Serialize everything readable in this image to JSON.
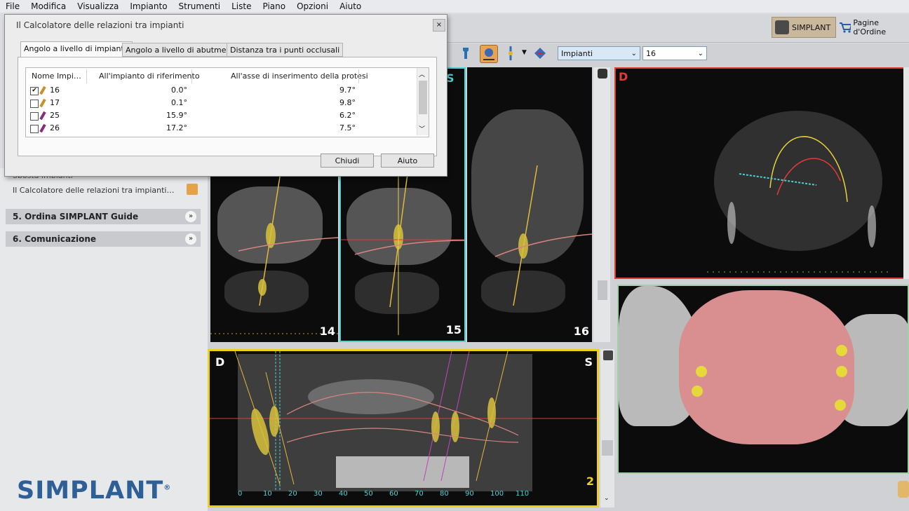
{
  "menu": [
    "File",
    "Modifica",
    "Visualizza",
    "Impianto",
    "Strumenti",
    "Liste",
    "Piano",
    "Opzioni",
    "Aiuto"
  ],
  "toolbar": {
    "simplant_tab": "SIMPLANT",
    "ordini_tab": "Pagine d'Ordine",
    "select_implants": "Impianti",
    "select_number": "16"
  },
  "dialog": {
    "title": "Il Calcolatore delle relazioni tra impianti",
    "close": "×",
    "tabs": [
      "Angolo a livello di impianto",
      "Angolo a livello di abutment",
      "Distanza tra i punti occlusali"
    ],
    "columns": [
      "Nome Impi…",
      "All'impianto di riferimento",
      "All'asse di inserimento della protesi"
    ],
    "rows": [
      {
        "checked": "✔",
        "id": "16",
        "ref": "0.0°",
        "prot": "9.7°",
        "pen": "#c8912a"
      },
      {
        "checked": "",
        "id": "17",
        "ref": "0.1°",
        "prot": "9.8°",
        "pen": "#c8912a"
      },
      {
        "checked": "",
        "id": "25",
        "ref": "15.9°",
        "prot": "6.2°",
        "pen": "#8b2b7a"
      },
      {
        "checked": "",
        "id": "26",
        "ref": "17.2°",
        "prot": "7.5°",
        "pen": "#8b2b7a"
      }
    ],
    "buttons": {
      "close": "Chiudi",
      "help": "Aiuto"
    }
  },
  "left_panel": {
    "truncated_item": "Sposta impianti",
    "calc_item": "Il Calcolatore delle relazioni tra impianti…",
    "section5": "5. Ordina SIMPLANT Guide",
    "section6": "6. Comunicazione",
    "chevron": "»",
    "brand": "SIMPLANT",
    "brand_reg": "®"
  },
  "views": {
    "slice_labels": [
      "14",
      "15",
      "16"
    ],
    "slice_side": "S",
    "axial_side": "D",
    "pano_left": "D",
    "pano_right": "S",
    "pano_number": "2",
    "pano_ruler": [
      "0",
      "10",
      "20",
      "30",
      "40",
      "50",
      "60",
      "70",
      "80",
      "90",
      "100",
      "110"
    ]
  },
  "colors": {
    "yellow_border": "#e9d21a",
    "cyan_border": "#4fd0d2",
    "red_border": "#e03a3a",
    "green_border": "#9fd3a3",
    "implant": "#d7c13c",
    "gum": "#d9857f"
  }
}
